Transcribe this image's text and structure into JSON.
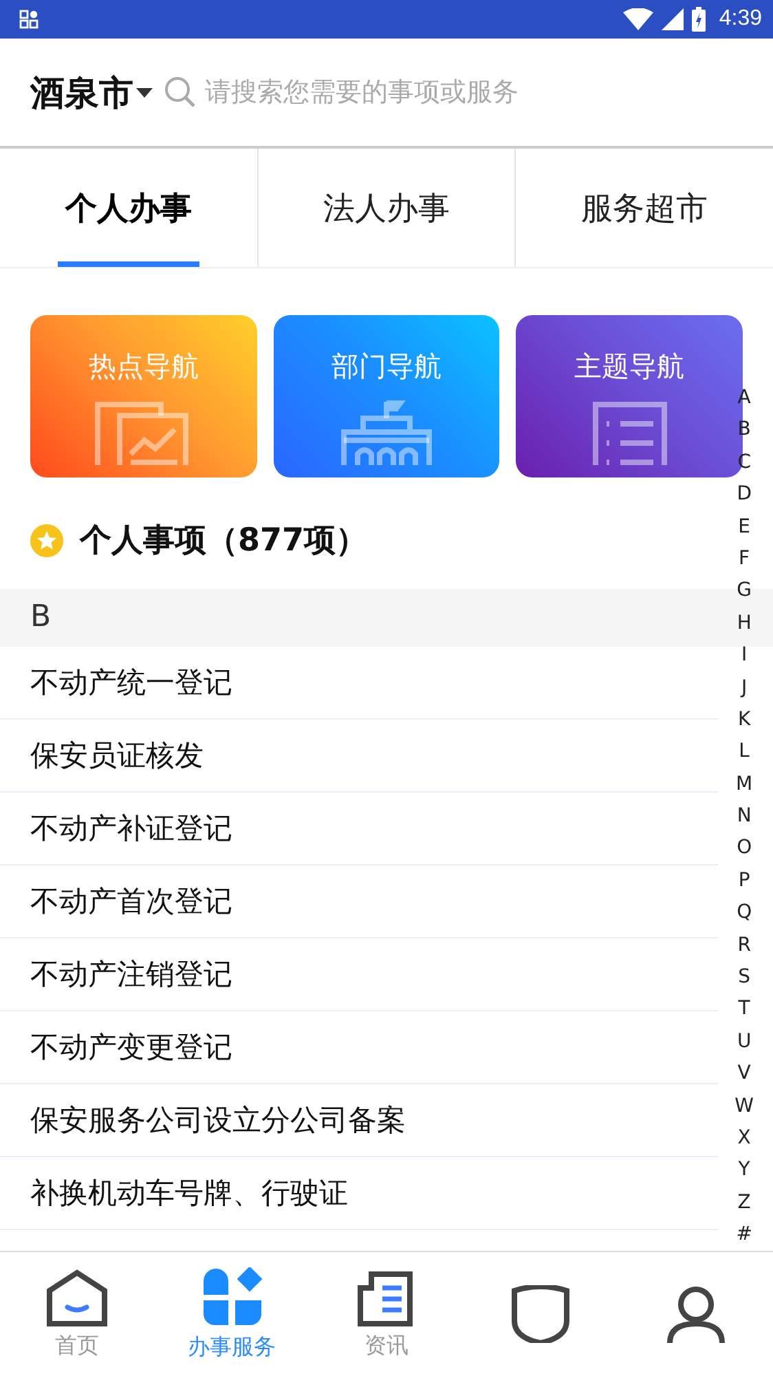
{
  "status_bar": {
    "time": "4:39"
  },
  "header": {
    "city": "酒泉市",
    "search_placeholder": "请搜索您需要的事项或服务"
  },
  "tabs": [
    {
      "label": "个人办事",
      "selected": true
    },
    {
      "label": "法人办事",
      "selected": false
    },
    {
      "label": "服务超市",
      "selected": false
    }
  ],
  "nav_cards": [
    {
      "label": "热点导航",
      "kind": "chart"
    },
    {
      "label": "部门导航",
      "kind": "building"
    },
    {
      "label": "主题导航",
      "kind": "list"
    }
  ],
  "section_title": "个人事项（877项）",
  "group_header": "B",
  "items": [
    "不动产统一登记",
    "保安员证核发",
    "不动产补证登记",
    "不动产首次登记",
    "不动产注销登记",
    "不动产变更登记",
    "保安服务公司设立分公司备案",
    "补换机动车号牌、行驶证"
  ],
  "index_letters": [
    "A",
    "B",
    "C",
    "D",
    "E",
    "F",
    "G",
    "H",
    "I",
    "J",
    "K",
    "L",
    "M",
    "N",
    "O",
    "P",
    "Q",
    "R",
    "S",
    "T",
    "U",
    "V",
    "W",
    "X",
    "Y",
    "Z",
    "#"
  ],
  "bottom_nav": [
    {
      "kind": "home",
      "label": "首页",
      "selected": false
    },
    {
      "kind": "services",
      "label": "办事服务",
      "selected": true
    },
    {
      "kind": "news",
      "label": "资讯",
      "selected": false
    },
    {
      "kind": "shield",
      "selected": false
    },
    {
      "kind": "person",
      "selected": false
    }
  ]
}
